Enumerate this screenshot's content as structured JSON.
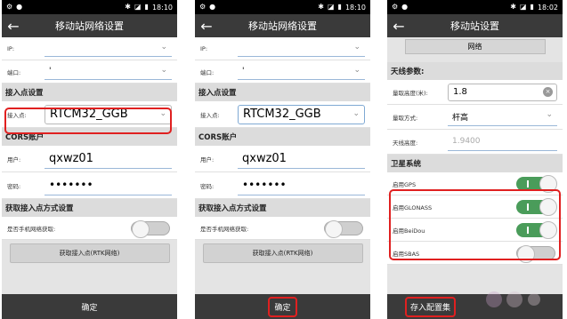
{
  "status_bar": {
    "time_a": "18:10",
    "time_b": "18:10",
    "time_c": "18:02"
  },
  "screen1": {
    "title": "移动站网络设置",
    "ip_label": "IP:",
    "port_label": "端口:",
    "port_value": "'",
    "section_access": "接入点设置",
    "access_label": "接入点:",
    "access_value": "RTCM32_GGB",
    "section_cors": "CORS账户",
    "user_label": "用户:",
    "user_value": "qxwz01",
    "pwd_label": "密码:",
    "pwd_value": "•••••••",
    "section_fetch": "获取接入点方式设置",
    "phone_net_label": "是否手机网络获取:",
    "fetch_button": "获取接入点(RTK网络)",
    "confirm": "确定"
  },
  "screen2": {
    "title": "移动站网络设置",
    "ip_label": "IP:",
    "port_label": "端口:",
    "port_value": "'",
    "section_access": "接入点设置",
    "access_label": "接入点:",
    "access_value": "RTCM32_GGB",
    "section_cors": "CORS账户",
    "user_label": "用户:",
    "user_value": "qxwz01",
    "pwd_label": "密码:",
    "pwd_value": "•••••••",
    "section_fetch": "获取接入点方式设置",
    "phone_net_label": "是否手机网络获取:",
    "fetch_button": "获取接入点(RTK网络)",
    "confirm": "确定"
  },
  "screen3": {
    "title": "移动站设置",
    "network_tab": "网络",
    "section_antenna": "天线参数:",
    "height_label": "量取高度(米):",
    "height_value": "1.8",
    "method_label": "量取方式:",
    "method_value": "杆高",
    "antenna_height_label": "天线高度:",
    "antenna_height_value": "1.9400",
    "section_satellite": "卫星系统",
    "gps_label": "启用GPS",
    "glonass_label": "启用GLONASS",
    "beidou_label": "启用BeiDou",
    "sbas_label": "启用SBAS",
    "save_button": "存入配置集"
  },
  "colors": {
    "highlight": "#e02020",
    "toggle_on": "#4a9c5a",
    "title_bar": "#3a3a3a"
  }
}
